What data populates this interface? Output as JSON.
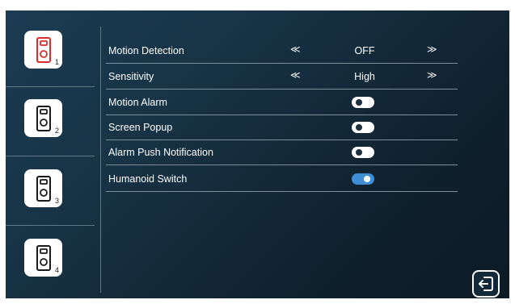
{
  "sidebar": {
    "cameras": [
      {
        "number": "1",
        "selected": true,
        "icon": "doorbell-camera-icon"
      },
      {
        "number": "2",
        "selected": false,
        "icon": "doorbell-camera-icon"
      },
      {
        "number": "3",
        "selected": false,
        "icon": "doorbell-camera-icon"
      },
      {
        "number": "4",
        "selected": false,
        "icon": "doorbell-camera-icon"
      }
    ]
  },
  "settings": {
    "motion_detection": {
      "label": "Motion Detection",
      "value": "OFF"
    },
    "sensitivity": {
      "label": "Sensitivity",
      "value": "High"
    },
    "motion_alarm": {
      "label": "Motion Alarm",
      "enabled": false
    },
    "screen_popup": {
      "label": "Screen Popup",
      "enabled": false
    },
    "alarm_push": {
      "label": "Alarm Push Notification",
      "enabled": false
    },
    "humanoid_switch": {
      "label": "Humanoid Switch",
      "enabled": true
    }
  },
  "colors": {
    "selected_icon": "#e02b2b",
    "toggle_on": "#3f8ed6",
    "toggle_off": "#ffffff"
  },
  "glyphs": {
    "prev": "≪",
    "next": "≫"
  },
  "exit_icon": "exit-icon"
}
